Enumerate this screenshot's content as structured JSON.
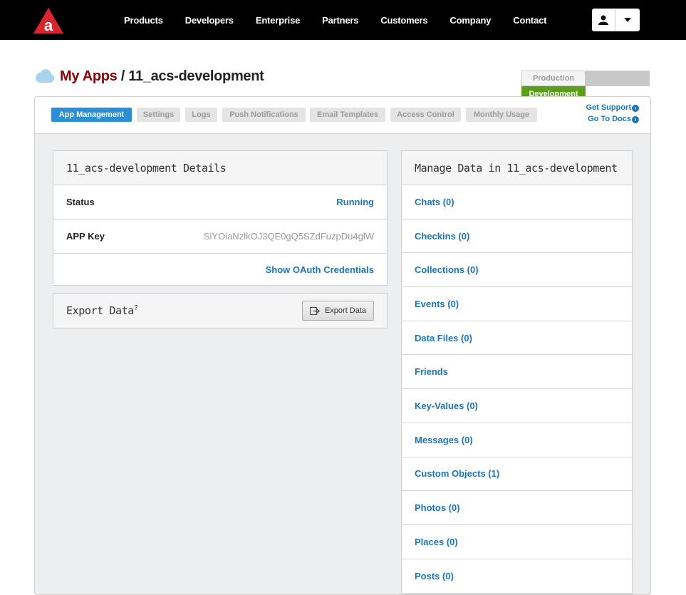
{
  "nav": {
    "links": [
      "Products",
      "Developers",
      "Enterprise",
      "Partners",
      "Customers",
      "Company",
      "Contact"
    ]
  },
  "title": {
    "my_apps": "My Apps",
    "separator": " / ",
    "app_name": "11_acs-development"
  },
  "env": {
    "production": "Production",
    "development": "Development"
  },
  "tabs": [
    "App Management",
    "Settings",
    "Logs",
    "Push Notifications",
    "Email Templates",
    "Access Control",
    "Monthly Usage"
  ],
  "support": {
    "get_support": "Get Support",
    "go_to_docs": "Go To Docs"
  },
  "details": {
    "heading": "11_acs-development Details",
    "status_label": "Status",
    "status_value": "Running",
    "key_label": "APP Key",
    "key_value": "SlYOiaNzlkOJ3QE0gQ5SZdFuzpDu4glW",
    "oauth_link": "Show OAuth Credentials"
  },
  "export": {
    "heading": "Export Data",
    "superscript": "?",
    "button": "Export Data"
  },
  "manage": {
    "heading": "Manage Data in 11_acs-development",
    "items": [
      "Chats (0)",
      "Checkins (0)",
      "Collections (0)",
      "Events (0)",
      "Data Files (0)",
      "Friends",
      "Key-Values (0)",
      "Messages (0)",
      "Custom Objects (1)",
      "Photos (0)",
      "Places (0)",
      "Posts (0)"
    ]
  },
  "colors": {
    "accent_blue": "#2b8fd6",
    "link_blue": "#1a75bb",
    "brand_red": "#d9262c",
    "dev_green": "#5a9e1a",
    "title_red": "#8b0000"
  }
}
